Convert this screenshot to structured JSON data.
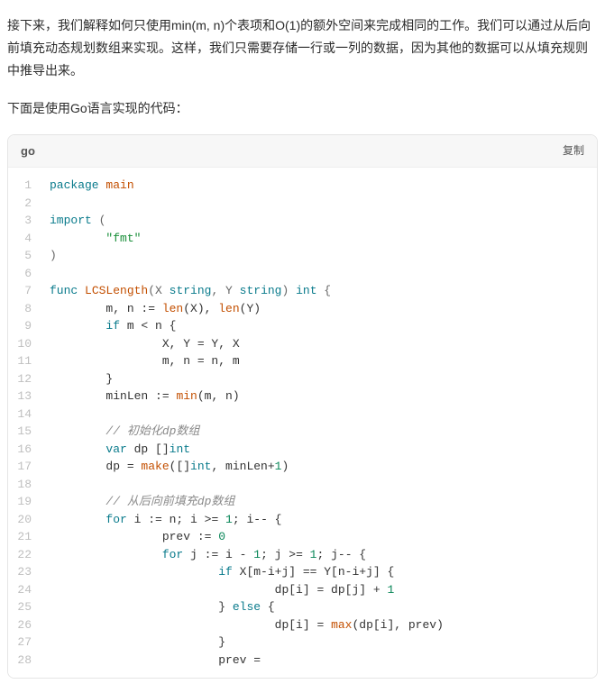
{
  "paragraphs": {
    "p1": "接下来，我们解释如何只使用min(m, n)个表项和O(1)的额外空间来完成相同的工作。我们可以通过从后向前填充动态规划数组来实现。这样，我们只需要存储一行或一列的数据，因为其他的数据可以从填充规则中推导出来。",
    "p2": "下面是使用Go语言实现的代码："
  },
  "code": {
    "lang": "go",
    "copy_label": "复制",
    "lines": [
      [
        {
          "t": "package ",
          "c": "tok-kw"
        },
        {
          "t": "main",
          "c": "tok-name"
        }
      ],
      [],
      [
        {
          "t": "import ",
          "c": "tok-kw"
        },
        {
          "t": "(",
          "c": "tok-punc"
        }
      ],
      [
        {
          "t": "        ",
          "c": ""
        },
        {
          "t": "\"fmt\"",
          "c": "tok-str"
        }
      ],
      [
        {
          "t": ")",
          "c": "tok-punc"
        }
      ],
      [],
      [
        {
          "t": "func ",
          "c": "tok-kw"
        },
        {
          "t": "LCSLength",
          "c": "tok-name"
        },
        {
          "t": "(X ",
          "c": "tok-punc"
        },
        {
          "t": "string",
          "c": "tok-kw"
        },
        {
          "t": ", Y ",
          "c": "tok-punc"
        },
        {
          "t": "string",
          "c": "tok-kw"
        },
        {
          "t": ") ",
          "c": "tok-punc"
        },
        {
          "t": "int",
          "c": "tok-kw"
        },
        {
          "t": " {",
          "c": "tok-punc"
        }
      ],
      [
        {
          "t": "        m, n := ",
          "c": ""
        },
        {
          "t": "len",
          "c": "tok-name"
        },
        {
          "t": "(X), ",
          "c": ""
        },
        {
          "t": "len",
          "c": "tok-name"
        },
        {
          "t": "(Y)",
          "c": ""
        }
      ],
      [
        {
          "t": "        ",
          "c": ""
        },
        {
          "t": "if",
          "c": "tok-kw"
        },
        {
          "t": " m < n {",
          "c": ""
        }
      ],
      [
        {
          "t": "                X, Y = Y, X",
          "c": ""
        }
      ],
      [
        {
          "t": "                m, n = n, m",
          "c": ""
        }
      ],
      [
        {
          "t": "        }",
          "c": ""
        }
      ],
      [
        {
          "t": "        minLen := ",
          "c": ""
        },
        {
          "t": "min",
          "c": "tok-name"
        },
        {
          "t": "(m, n)",
          "c": ""
        }
      ],
      [],
      [
        {
          "t": "        ",
          "c": ""
        },
        {
          "t": "// 初始化dp数组",
          "c": "tok-comment"
        }
      ],
      [
        {
          "t": "        ",
          "c": ""
        },
        {
          "t": "var",
          "c": "tok-kw"
        },
        {
          "t": " dp []",
          "c": ""
        },
        {
          "t": "int",
          "c": "tok-kw"
        }
      ],
      [
        {
          "t": "        dp = ",
          "c": ""
        },
        {
          "t": "make",
          "c": "tok-name"
        },
        {
          "t": "([]",
          "c": ""
        },
        {
          "t": "int",
          "c": "tok-kw"
        },
        {
          "t": ", minLen+",
          "c": ""
        },
        {
          "t": "1",
          "c": "tok-const"
        },
        {
          "t": ")",
          "c": ""
        }
      ],
      [],
      [
        {
          "t": "        ",
          "c": ""
        },
        {
          "t": "// 从后向前填充dp数组",
          "c": "tok-comment"
        }
      ],
      [
        {
          "t": "        ",
          "c": ""
        },
        {
          "t": "for",
          "c": "tok-kw"
        },
        {
          "t": " i := n; i >= ",
          "c": ""
        },
        {
          "t": "1",
          "c": "tok-const"
        },
        {
          "t": "; i-- {",
          "c": ""
        }
      ],
      [
        {
          "t": "                prev := ",
          "c": ""
        },
        {
          "t": "0",
          "c": "tok-const"
        }
      ],
      [
        {
          "t": "                ",
          "c": ""
        },
        {
          "t": "for",
          "c": "tok-kw"
        },
        {
          "t": " j := i - ",
          "c": ""
        },
        {
          "t": "1",
          "c": "tok-const"
        },
        {
          "t": "; j >= ",
          "c": ""
        },
        {
          "t": "1",
          "c": "tok-const"
        },
        {
          "t": "; j-- {",
          "c": ""
        }
      ],
      [
        {
          "t": "                        ",
          "c": ""
        },
        {
          "t": "if",
          "c": "tok-kw"
        },
        {
          "t": " X[m-i+j] == Y[n-i+j] {",
          "c": ""
        }
      ],
      [
        {
          "t": "                                dp[i] = dp[j] + ",
          "c": ""
        },
        {
          "t": "1",
          "c": "tok-const"
        }
      ],
      [
        {
          "t": "                        } ",
          "c": ""
        },
        {
          "t": "else",
          "c": "tok-kw"
        },
        {
          "t": " {",
          "c": ""
        }
      ],
      [
        {
          "t": "                                dp[i] = ",
          "c": ""
        },
        {
          "t": "max",
          "c": "tok-name"
        },
        {
          "t": "(dp[i], prev)",
          "c": ""
        }
      ],
      [
        {
          "t": "                        }",
          "c": ""
        }
      ],
      [
        {
          "t": "                        prev =",
          "c": ""
        }
      ]
    ]
  }
}
